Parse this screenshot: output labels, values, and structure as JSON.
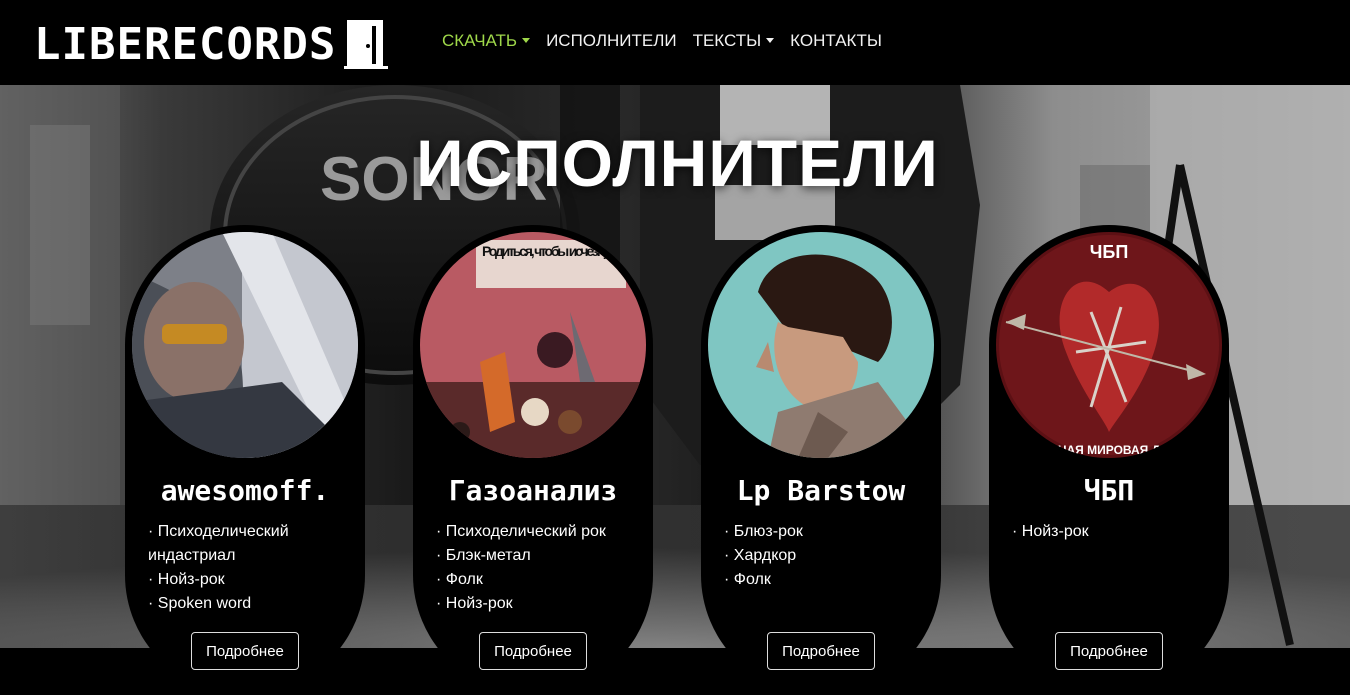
{
  "brand": {
    "name": "LIBERECORDS"
  },
  "nav": {
    "items": [
      {
        "label": "СКАЧАТЬ",
        "dropdown": true,
        "active": true
      },
      {
        "label": "ИСПОЛНИТЕЛИ",
        "dropdown": false,
        "active": false
      },
      {
        "label": "ТЕКСТЫ",
        "dropdown": true,
        "active": false
      },
      {
        "label": "КОНТАКТЫ",
        "dropdown": false,
        "active": false
      }
    ]
  },
  "colors": {
    "accent": "#9fd84a",
    "background": "#000000",
    "text": "#ffffff"
  },
  "page": {
    "title": "ИСПОЛНИТЕЛИ"
  },
  "artists": [
    {
      "name": "awesomoff.",
      "genres": [
        "· Психоделический индастриал",
        "· Нойз-рок",
        "· Spoken word"
      ],
      "button": "Подробнее"
    },
    {
      "name": "Газоанализ",
      "genres": [
        "· Психоделический рок",
        "· Блэк-метал",
        "· Фолк",
        "· Нойз-рок"
      ],
      "button": "Подробнее",
      "cover_text": "Родиться, чтобы исчезнуть"
    },
    {
      "name": "Lp Barstow",
      "genres": [
        "· Блюз-рок",
        "· Хардкор",
        "· Фолк"
      ],
      "button": "Подробнее"
    },
    {
      "name": "ЧБП",
      "genres": [
        "· Нойз-рок"
      ],
      "button": "Подробнее",
      "cover_text": "ЧБП",
      "cover_subtext": "…НАЯ МИРОВАЯ Д…"
    }
  ]
}
